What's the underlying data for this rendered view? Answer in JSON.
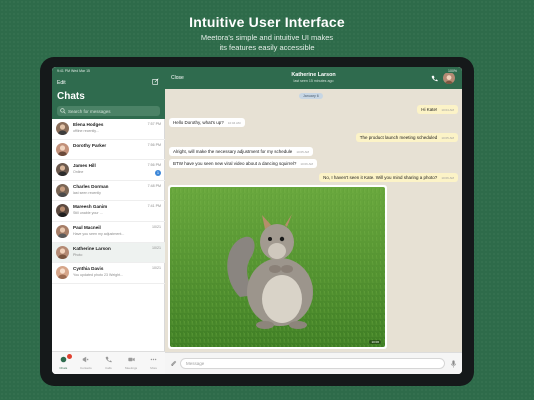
{
  "promo": {
    "title": "Intuitive User Interface",
    "subtitle_line1": "Meetora's simple and intuitive UI makes",
    "subtitle_line2": "its features easily accessible"
  },
  "sidebar": {
    "status_time": "9:41 PM  Wed Mar 15",
    "edit_label": "Edit",
    "title": "Chats",
    "search_placeholder": "Search for messages",
    "chats": [
      {
        "name": "Elena Hodges",
        "preview": "offline recently...",
        "time": "7:57 PM",
        "avatar": "#8a6e5a"
      },
      {
        "name": "Dorothy Parker",
        "preview": "",
        "time": "7:56 PM",
        "avatar": "#c2917a"
      },
      {
        "name": "James Hill",
        "preview": "Online",
        "time": "7:56 PM",
        "avatar": "#6c5a4e",
        "badge": "1"
      },
      {
        "name": "Charles Dorman",
        "preview": "last seen recently",
        "time": "7:48 PM",
        "avatar": "#7a6655"
      },
      {
        "name": "Mareesh Ganim",
        "preview": "Still unable your ...",
        "time": "7:41 PM",
        "avatar": "#5c4a40"
      },
      {
        "name": "Paul Macneil",
        "preview": "Have you seen my adjustment...",
        "time": "10/21",
        "avatar": "#a67e67"
      },
      {
        "name": "Katherine Larson",
        "preview": "Photo",
        "time": "10/21",
        "avatar": "#b48a74"
      },
      {
        "name": "Cynthia Davis",
        "preview": "You updated photo 23 Weight...",
        "time": "10/21",
        "avatar": "#d6a68a"
      }
    ],
    "tabs": [
      {
        "label": "Chats",
        "icon": "chat-icon"
      },
      {
        "label": "Contacts",
        "icon": "megaphone-icon"
      },
      {
        "label": "Calls",
        "icon": "phone-icon"
      },
      {
        "label": "Meetings",
        "icon": "video-icon"
      },
      {
        "label": "More",
        "icon": "more-icon"
      }
    ]
  },
  "chat": {
    "close_label": "Close",
    "contact_name": "Katherine Larson",
    "contact_status": "last seen 15 minutes ago",
    "status_right": "100%",
    "date_chip": "January 6",
    "messages": [
      {
        "dir": "out",
        "text": "Hi Kate!",
        "time": "10:04 AM"
      },
      {
        "dir": "in",
        "text": "Hello Dorothy, what's up?",
        "time": "10:04 AM"
      },
      {
        "dir": "out",
        "text": "The product launch meeting scheduled",
        "time": "10:05 AM"
      },
      {
        "dir": "in",
        "text": "Alright, will make the necessary adjustment for my schedule",
        "time": "10:05 AM"
      },
      {
        "dir": "in",
        "text": "BTW have you seen new viral video about a dancing squirrel?",
        "time": "10:06 AM"
      },
      {
        "dir": "out",
        "text": "No, I haven't seen it Kate. Will you mind sharing a photo?",
        "time": "10:06 AM"
      }
    ],
    "photo_time": "10:06",
    "composer_placeholder": "Message"
  },
  "colors": {
    "brand_green": "#2f6b4e",
    "outgoing_bubble": "#fcf3c7",
    "chat_background": "#e7e1d4"
  }
}
